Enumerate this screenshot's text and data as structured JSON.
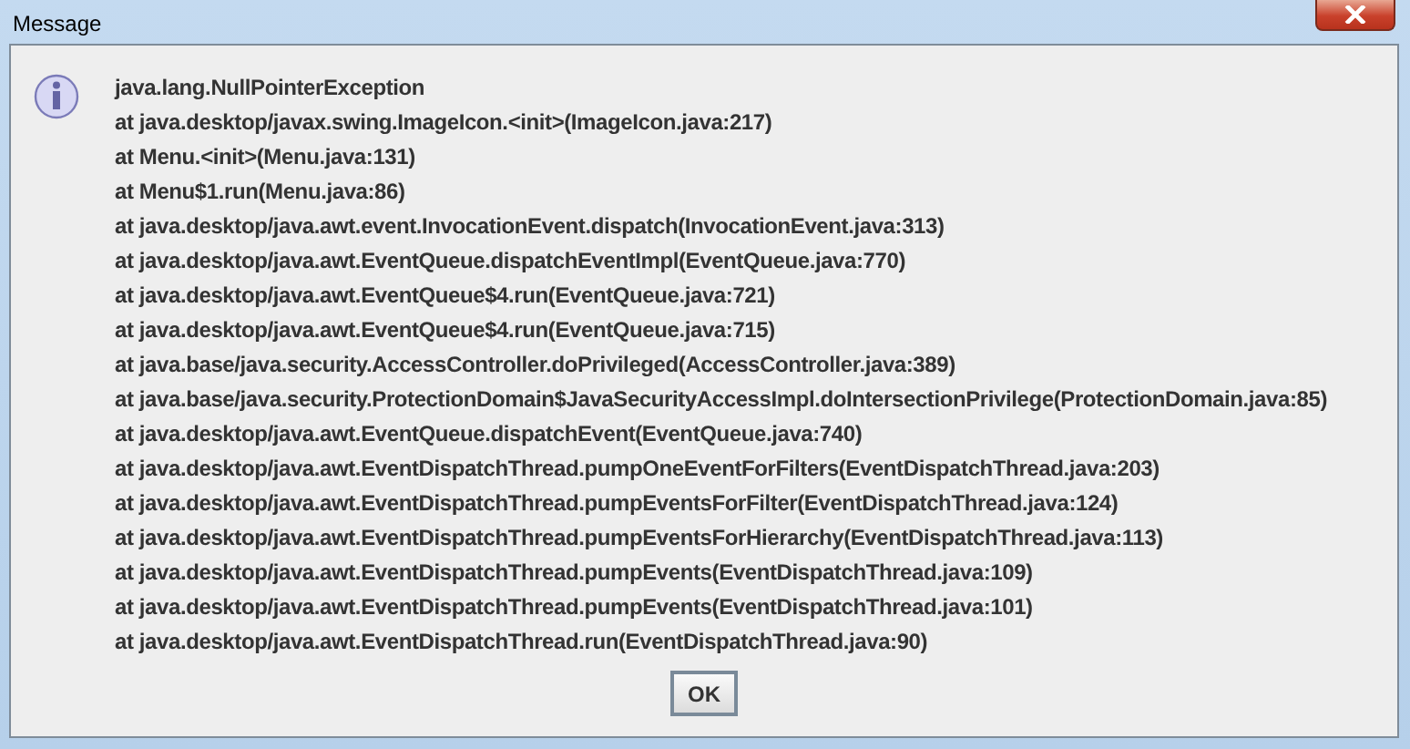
{
  "window": {
    "title": "Message"
  },
  "message": {
    "lines": [
      "java.lang.NullPointerException",
      "at java.desktop/javax.swing.ImageIcon.<init>(ImageIcon.java:217)",
      "at Menu.<init>(Menu.java:131)",
      "at Menu$1.run(Menu.java:86)",
      "at java.desktop/java.awt.event.InvocationEvent.dispatch(InvocationEvent.java:313)",
      "at java.desktop/java.awt.EventQueue.dispatchEventImpl(EventQueue.java:770)",
      "at java.desktop/java.awt.EventQueue$4.run(EventQueue.java:721)",
      "at java.desktop/java.awt.EventQueue$4.run(EventQueue.java:715)",
      "at java.base/java.security.AccessController.doPrivileged(AccessController.java:389)",
      "at java.base/java.security.ProtectionDomain$JavaSecurityAccessImpl.doIntersectionPrivilege(ProtectionDomain.java:85)",
      "at java.desktop/java.awt.EventQueue.dispatchEvent(EventQueue.java:740)",
      "at java.desktop/java.awt.EventDispatchThread.pumpOneEventForFilters(EventDispatchThread.java:203)",
      "at java.desktop/java.awt.EventDispatchThread.pumpEventsForFilter(EventDispatchThread.java:124)",
      "at java.desktop/java.awt.EventDispatchThread.pumpEventsForHierarchy(EventDispatchThread.java:113)",
      "at java.desktop/java.awt.EventDispatchThread.pumpEvents(EventDispatchThread.java:109)",
      "at java.desktop/java.awt.EventDispatchThread.pumpEvents(EventDispatchThread.java:101)",
      "at java.desktop/java.awt.EventDispatchThread.run(EventDispatchThread.java:90)"
    ]
  },
  "buttons": [
    "OK"
  ]
}
